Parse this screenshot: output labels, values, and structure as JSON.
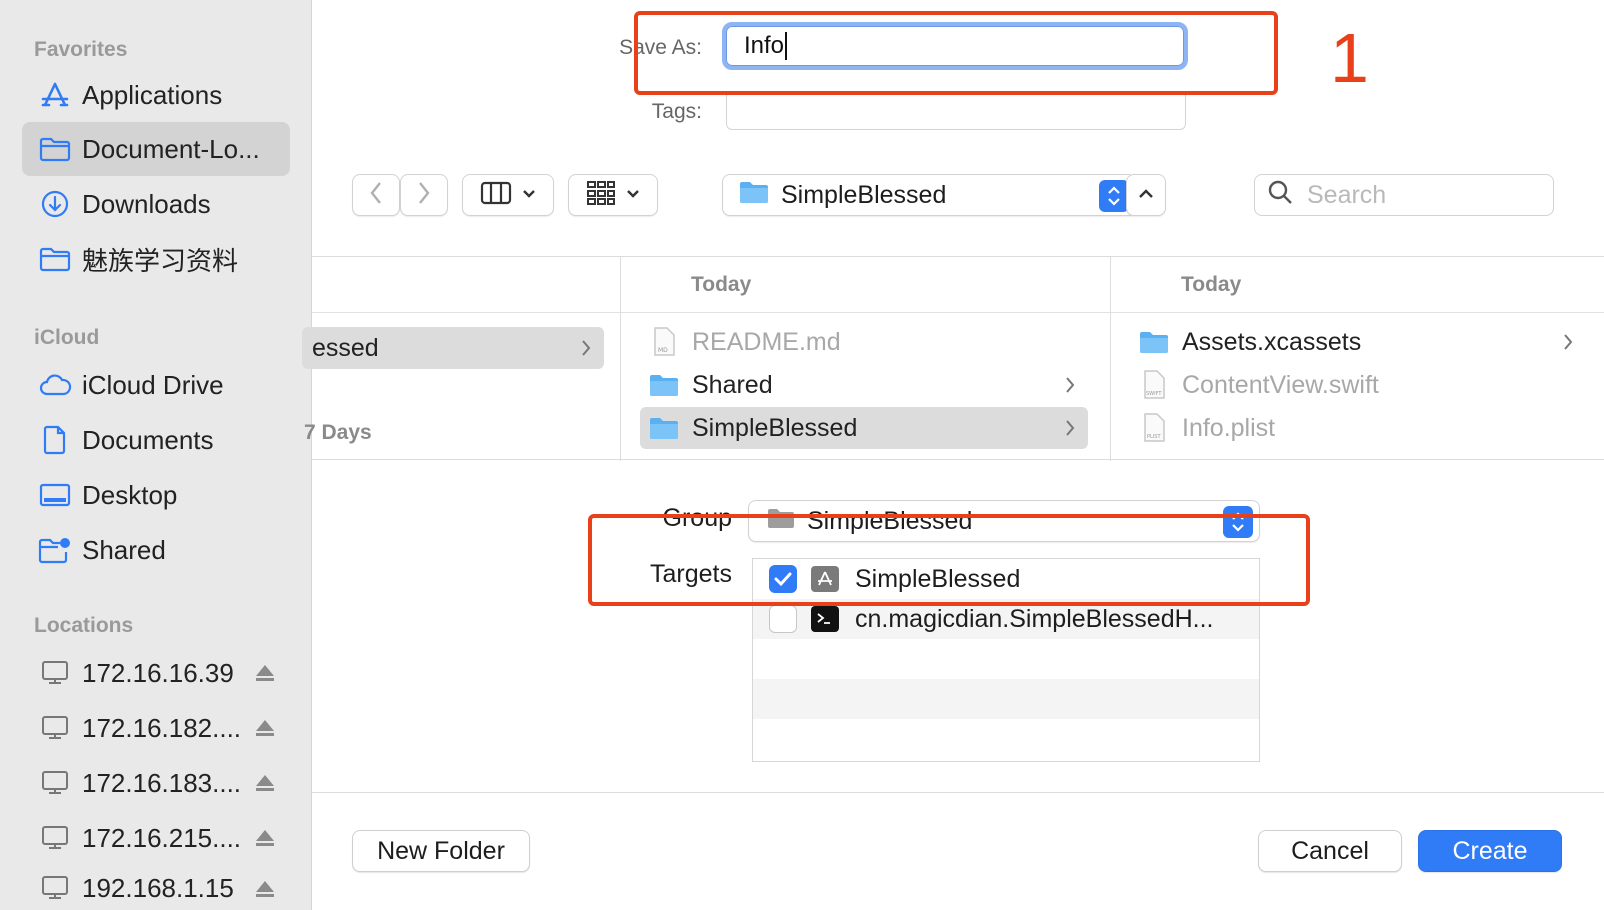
{
  "sidebar": {
    "sections": [
      {
        "title": "Favorites",
        "items": [
          {
            "label": "Applications",
            "icon": "applications-icon"
          },
          {
            "label": "Document-Lo...",
            "icon": "folder-icon",
            "selected": true
          },
          {
            "label": "Downloads",
            "icon": "downloads-icon"
          },
          {
            "label": "魅族学习资料",
            "icon": "folder-icon"
          }
        ]
      },
      {
        "title": "iCloud",
        "items": [
          {
            "label": "iCloud Drive",
            "icon": "cloud-icon"
          },
          {
            "label": "Documents",
            "icon": "document-icon"
          },
          {
            "label": "Desktop",
            "icon": "desktop-icon"
          },
          {
            "label": "Shared",
            "icon": "shared-folder-icon"
          }
        ]
      },
      {
        "title": "Locations",
        "items": [
          {
            "label": "172.16.16.39",
            "icon": "network-server-icon"
          },
          {
            "label": "172.16.182....",
            "icon": "network-server-icon"
          },
          {
            "label": "172.16.183....",
            "icon": "network-server-icon"
          },
          {
            "label": "172.16.215....",
            "icon": "network-server-icon"
          },
          {
            "label": "192.168.1.15",
            "icon": "network-server-icon"
          }
        ]
      }
    ]
  },
  "save_form": {
    "save_as_label": "Save As:",
    "save_as_value": "Info",
    "tags_label": "Tags:",
    "tags_value": ""
  },
  "annotation": {
    "number": "1",
    "color": "#e8411a"
  },
  "toolbar": {
    "current_folder": "SimpleBlessed",
    "search_placeholder": "Search"
  },
  "browser": {
    "col1": {
      "visible_label": "essed",
      "footer": "7 Days"
    },
    "col2": {
      "header": "Today",
      "items": [
        {
          "label": "README.md",
          "dim": true
        },
        {
          "label": "Shared",
          "dim": false
        },
        {
          "label": "SimpleBlessed",
          "dim": false,
          "selected": true
        }
      ]
    },
    "col3": {
      "header": "Today",
      "items": [
        {
          "label": "Assets.xcassets",
          "dim": false
        },
        {
          "label": "ContentView.swift",
          "dim": true
        },
        {
          "label": "Info.plist",
          "dim": true
        }
      ]
    }
  },
  "options": {
    "group_label": "Group",
    "group_value": "SimpleBlessed",
    "targets_label": "Targets",
    "targets": [
      {
        "label": "SimpleBlessed",
        "checked": true,
        "icon": "app-target-icon"
      },
      {
        "label": "cn.magicdian.SimpleBlessedH...",
        "checked": false,
        "icon": "terminal-target-icon"
      }
    ]
  },
  "buttons": {
    "new_folder": "New Folder",
    "cancel": "Cancel",
    "create": "Create"
  },
  "colors": {
    "accent": "#2f7cf6",
    "annotation": "#e8411a"
  }
}
